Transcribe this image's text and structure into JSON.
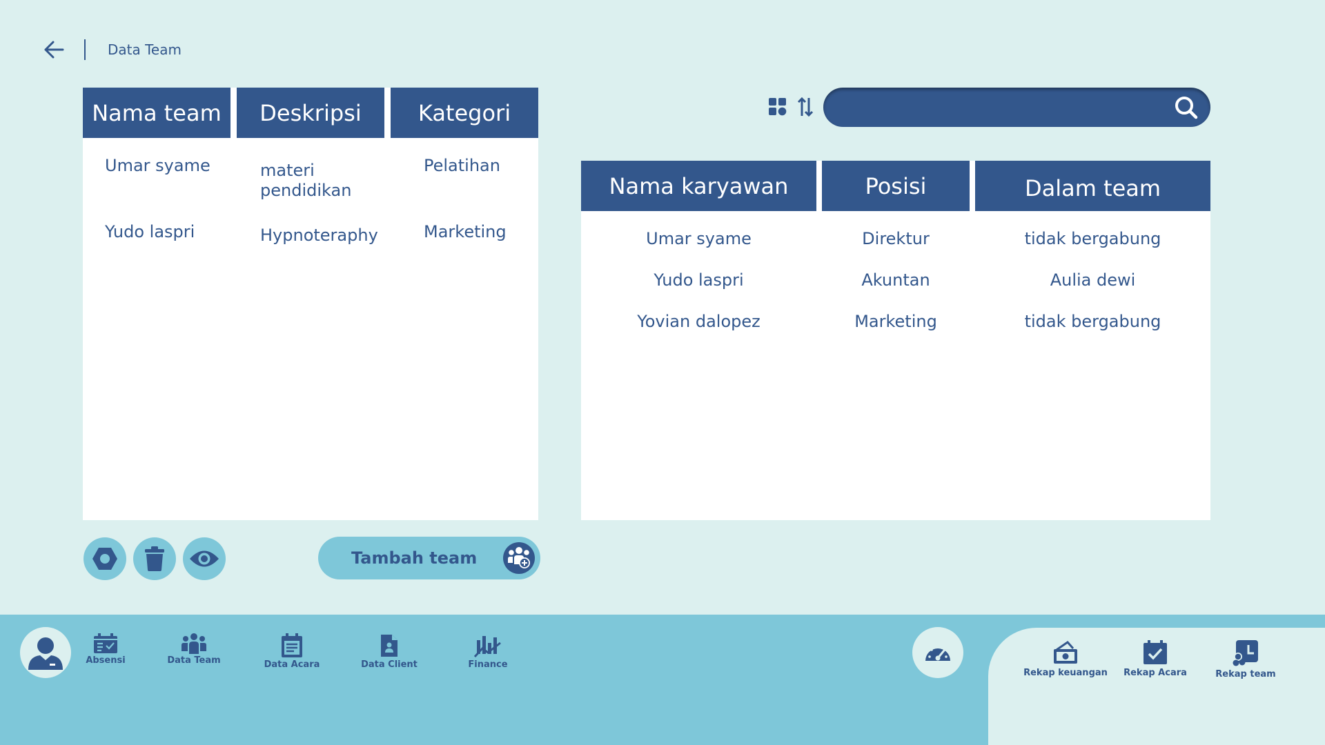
{
  "header": {
    "title": "Data Team"
  },
  "teams_table": {
    "columns": [
      "Nama team",
      "Deskripsi",
      "Kategori"
    ],
    "rows": [
      {
        "name": "Umar syame",
        "desc": "materi pendidikan",
        "category": "Pelatihan"
      },
      {
        "name": "Yudo laspri",
        "desc": "Hypnoteraphy",
        "category": "Marketing"
      }
    ]
  },
  "search": {
    "placeholder": ""
  },
  "employees_table": {
    "columns": [
      "Nama karyawan",
      "Posisi",
      "Dalam team"
    ],
    "rows": [
      {
        "name": "Umar syame",
        "position": "Direktur",
        "team": "tidak bergabung"
      },
      {
        "name": "Yudo laspri",
        "position": "Akuntan",
        "team": "Aulia dewi"
      },
      {
        "name": "Yovian dalopez",
        "position": "Marketing",
        "team": "tidak bergabung"
      }
    ]
  },
  "actions": {
    "add_team": "Tambah team"
  },
  "nav": {
    "items": [
      {
        "label": "Absensi",
        "icon": "calendar-check-icon"
      },
      {
        "label": "Data Team",
        "icon": "users-icon"
      },
      {
        "label": "Data Acara",
        "icon": "calendar-list-icon"
      },
      {
        "label": "Data Client",
        "icon": "client-file-icon"
      },
      {
        "label": "Finance",
        "icon": "chart-icon"
      }
    ],
    "rekap": [
      {
        "label": "Rekap keuangan",
        "icon": "money-icon"
      },
      {
        "label": "Rekap Acara",
        "icon": "calendar-check-icon"
      },
      {
        "label": "Rekap team",
        "icon": "team-report-icon"
      }
    ]
  },
  "colors": {
    "primary": "#33578c",
    "background": "#dcf0ef",
    "accent": "#7ec7d9",
    "panel": "#ffffff"
  }
}
